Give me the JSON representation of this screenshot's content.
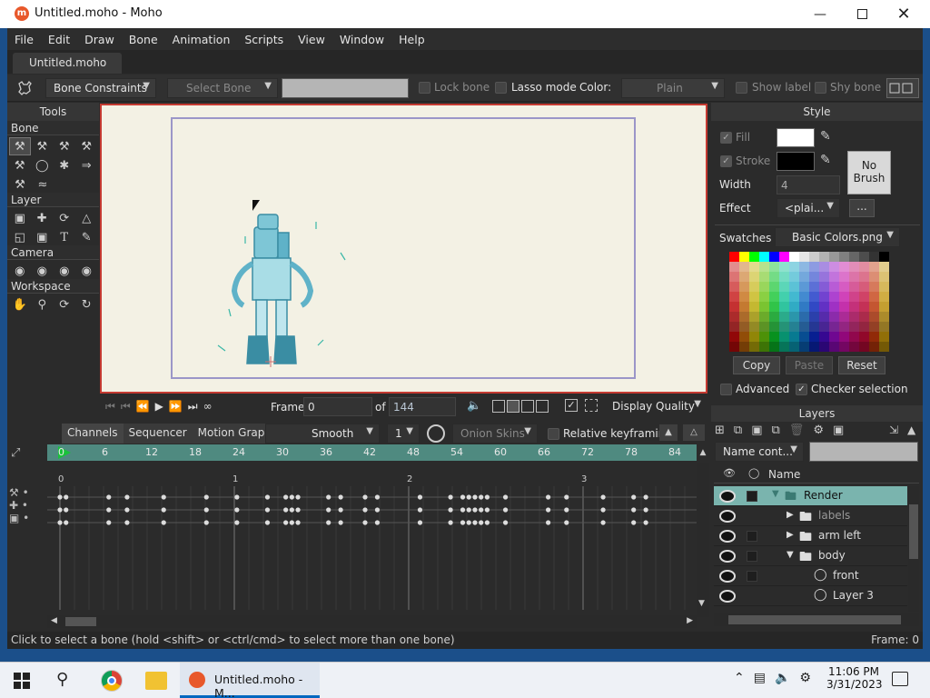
{
  "window": {
    "title": "Untitled.moho - Moho",
    "logo": "m"
  },
  "menu": [
    "File",
    "Edit",
    "Draw",
    "Bone",
    "Animation",
    "Scripts",
    "View",
    "Window",
    "Help"
  ],
  "doc_tab": "Untitled.moho",
  "toolbar": {
    "bone_constraints": "Bone Constraints",
    "select_bone": "Select Bone",
    "lock_bone": "Lock bone",
    "lasso_mode": "Lasso mode",
    "color_label": "Color:",
    "color_value": "Plain",
    "show_label": "Show label",
    "shy_bone": "Shy bone"
  },
  "tools": {
    "title": "Tools",
    "sections": {
      "bone": "Bone",
      "layer": "Layer",
      "camera": "Camera",
      "workspace": "Workspace"
    }
  },
  "playback": {
    "frame_label": "Frame",
    "frame_value": "0",
    "of_label": "of",
    "total": "144",
    "display_quality": "Display Quality"
  },
  "style": {
    "title": "Style",
    "fill": "Fill",
    "stroke": "Stroke",
    "width_label": "Width",
    "width_value": "4",
    "effect_label": "Effect",
    "effect_value": "<plai...",
    "effect_more": "...",
    "no_brush": "No Brush",
    "swatches_label": "Swatches",
    "swatches_value": "Basic Colors.png",
    "copy": "Copy",
    "paste": "Paste",
    "reset": "Reset",
    "advanced": "Advanced",
    "checker_selection": "Checker selection"
  },
  "layers": {
    "title": "Layers",
    "filter": "Name cont...",
    "name_header": "Name",
    "rows": [
      {
        "name": "Render",
        "selected": true
      },
      {
        "name": "labels"
      },
      {
        "name": "arm left"
      },
      {
        "name": "body"
      },
      {
        "name": "front"
      },
      {
        "name": "Layer 3"
      }
    ]
  },
  "timeline": {
    "tabs": [
      "Channels",
      "Sequencer",
      "Motion Graph"
    ],
    "interp": "Smooth",
    "interp_count": "1",
    "onion_skins": "Onion Skins",
    "relative_keyframing": "Relative keyframing",
    "ruler": [
      "0",
      "6",
      "12",
      "18",
      "24",
      "30",
      "36",
      "42",
      "48",
      "54",
      "60",
      "66",
      "72",
      "78",
      "84"
    ],
    "seconds": [
      "0",
      "1",
      "2",
      "3"
    ]
  },
  "status": {
    "hint": "Click to select a bone (hold <shift> or <ctrl/cmd> to select more than one bone)",
    "frame": "Frame: 0"
  },
  "taskbar": {
    "app": "Untitled.moho - M...",
    "time": "11:06 PM",
    "date": "3/31/2023"
  },
  "colors": {
    "accent_selected_layer": "#7ab4ae",
    "canvas_border": "#c43a31",
    "stage_border": "#9b96c8",
    "ruler": "#4f8a80"
  }
}
